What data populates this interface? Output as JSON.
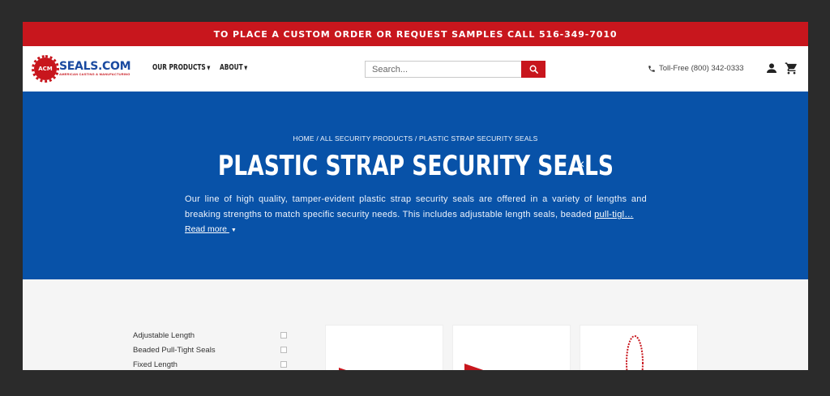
{
  "topbar": {
    "text": "TO PLACE A CUSTOM ORDER OR REQUEST SAMPLES CALL 516-349-7010"
  },
  "logo": {
    "badge": "ACM",
    "name": "SEALS.COM",
    "tagline": "AMERICAN CASTING & MANUFACTURING"
  },
  "nav": {
    "items": [
      {
        "label": "OUR PRODUCTS"
      },
      {
        "label": "ABOUT"
      }
    ]
  },
  "search": {
    "placeholder": "Search...",
    "value": ""
  },
  "header": {
    "tollfree": "Toll-Free (800) 342-0333"
  },
  "breadcrumb": {
    "home": "HOME",
    "sep": " / ",
    "parent": "ALL SECURITY PRODUCTS",
    "current": "PLASTIC STRAP SECURITY SEALS"
  },
  "hero": {
    "title": "PLASTIC STRAP SECURITY SEALS",
    "close_glyph": "×",
    "description_text": "Our line of high quality, tamper-evident plastic strap security seals are offered in a variety of lengths and breaking strengths to match specific security needs. This includes adjustable length seals, beaded ",
    "description_link": "pull-tigl…",
    "read_more": "Read more"
  },
  "filters": [
    {
      "label": "Adjustable Length",
      "checked": false
    },
    {
      "label": "Beaded Pull-Tight Seals",
      "checked": false
    },
    {
      "label": "Fixed Length",
      "checked": false
    }
  ],
  "colors": {
    "topbar": "#c8161d",
    "hero": "#0852a8",
    "accent": "#c8161d",
    "brand_blue": "#1a4aa0"
  },
  "icons": {
    "search": "search-icon",
    "phone": "phone-icon",
    "account": "account-icon",
    "cart": "cart-icon",
    "close": "close-icon"
  }
}
